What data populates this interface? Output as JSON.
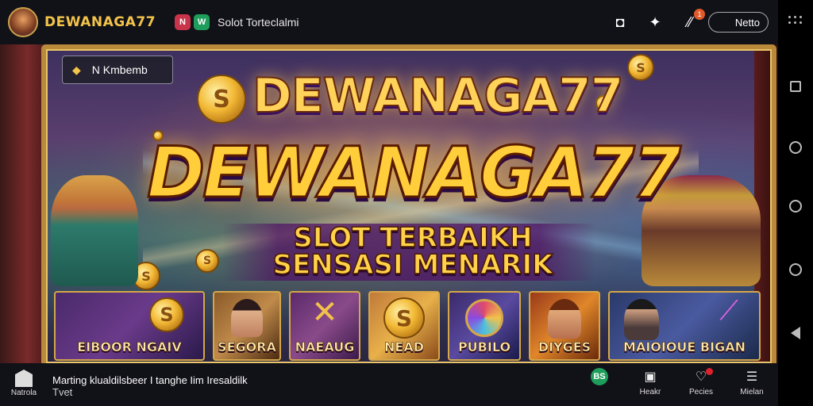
{
  "topbar": {
    "brand": "DEWANAGA77",
    "chip_red": "N",
    "chip_green": "W",
    "subtitle": "Solot Torteclalmi",
    "notification_count": "1",
    "pill_label": "Netto"
  },
  "banner": {
    "badge_label": "N  Kmbemb",
    "logo_small": "DEWANAGA77",
    "logo_large": "DEWANAGA77",
    "tagline_1": "SLOT TERBAIKH",
    "tagline_2": "SENSASI MENARIK",
    "tiles": [
      {
        "label": "EIBOOR  NGAIV"
      },
      {
        "label": "SEGORA"
      },
      {
        "label": "NAEAUG"
      },
      {
        "label": "NEAD"
      },
      {
        "label": "PUBILO"
      },
      {
        "label": "DIYGES"
      },
      {
        "label": "MAIOIOUE  BIGAN"
      }
    ]
  },
  "bottombar": {
    "home_label": "Natrola",
    "notice_line1": "Marting klualdilsbeer I tanghe Iim Iresaldilk",
    "notice_line2": "Tvet",
    "items": [
      {
        "label": "",
        "icon": "green-badge-icon",
        "text": "BS"
      },
      {
        "label": "Heakr",
        "icon": "clipboard-icon"
      },
      {
        "label": "Pecies",
        "icon": "heart-icon"
      },
      {
        "label": "Mielan",
        "icon": "menu-icon"
      }
    ]
  },
  "colors": {
    "accent_gold": "#f3c44a",
    "bar_bg": "#111118",
    "notification_red": "#e0202a",
    "green": "#1e9e5a"
  }
}
